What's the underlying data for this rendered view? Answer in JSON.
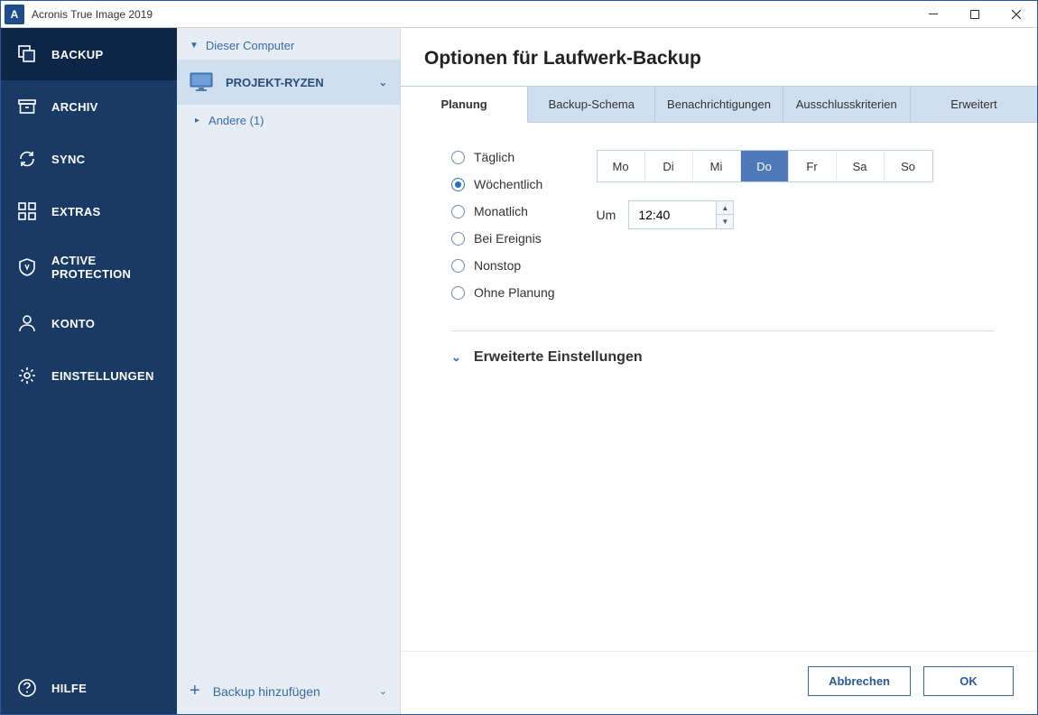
{
  "titlebar": {
    "appName": "Acronis True Image 2019",
    "iconLetter": "A"
  },
  "nav": {
    "items": [
      {
        "key": "backup",
        "label": "BACKUP"
      },
      {
        "key": "archive",
        "label": "ARCHIV"
      },
      {
        "key": "sync",
        "label": "SYNC"
      },
      {
        "key": "extras",
        "label": "EXTRAS"
      },
      {
        "key": "active-protection",
        "label": "ACTIVE PROTECTION"
      },
      {
        "key": "account",
        "label": "KONTO"
      },
      {
        "key": "settings",
        "label": "EINSTELLUNGEN"
      }
    ],
    "help": "HILFE"
  },
  "col2": {
    "headLabel": "Dieser Computer",
    "itemLabel": "PROJEKT-RYZEN",
    "otherLabel": "Andere (1)",
    "addBackupLabel": "Backup hinzufügen"
  },
  "main": {
    "title": "Optionen für Laufwerk-Backup",
    "tabs": [
      "Planung",
      "Backup-Schema",
      "Benachrichtigungen",
      "Ausschlusskriterien",
      "Erweitert"
    ],
    "activeTab": 0,
    "schedule": {
      "options": [
        "Täglich",
        "Wöchentlich",
        "Monatlich",
        "Bei Ereignis",
        "Nonstop",
        "Ohne Planung"
      ],
      "selected": 1,
      "days": [
        "Mo",
        "Di",
        "Mi",
        "Do",
        "Fr",
        "Sa",
        "So"
      ],
      "selectedDay": 3,
      "atLabel": "Um",
      "time": "12:40"
    },
    "advancedLabel": "Erweiterte Einstellungen"
  },
  "footer": {
    "cancel": "Abbrechen",
    "ok": "OK"
  }
}
